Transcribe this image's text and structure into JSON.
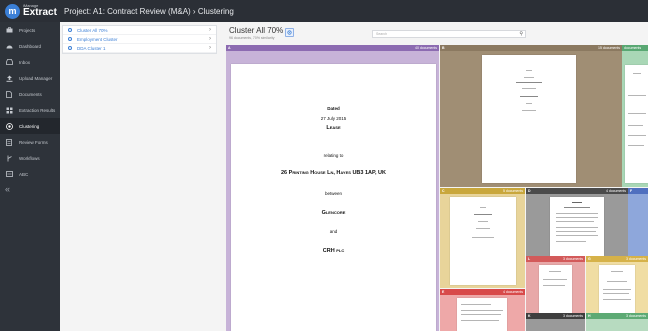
{
  "app": {
    "logo_letter": "m",
    "logo_small": "iManage",
    "logo_big": "Extract",
    "project_title": "Project: A1: Contract Review (M&A) › Clustering"
  },
  "sidebar": {
    "items": [
      {
        "label": "Projects",
        "icon": "briefcase-icon"
      },
      {
        "label": "Dashboard",
        "icon": "dashboard-icon"
      },
      {
        "label": "Inbox",
        "icon": "inbox-icon"
      },
      {
        "label": "Upload Manager",
        "icon": "upload-icon"
      },
      {
        "label": "Documents",
        "icon": "document-icon"
      },
      {
        "label": "Extraction Results",
        "icon": "grid-icon"
      },
      {
        "label": "Clustering",
        "icon": "target-icon",
        "active": true
      },
      {
        "label": "Review Forms",
        "icon": "form-icon"
      },
      {
        "label": "Workflows",
        "icon": "workflow-icon"
      },
      {
        "label": "ABC",
        "icon": "abc-icon"
      }
    ],
    "collapse": "«"
  },
  "cluster_list": [
    {
      "label": "Cluster All 70%"
    },
    {
      "label": "Employment Cluster"
    },
    {
      "label": "DDA Cluster 1"
    }
  ],
  "main": {
    "title": "Cluster All 70%",
    "subtitle": "96 documents, 70% similarity",
    "search_placeholder": "Search"
  },
  "panels": {
    "a": {
      "letter": "A",
      "count": "40 documents"
    },
    "b": {
      "letter": "B",
      "count": "15 documents"
    },
    "b2": {
      "letter": "",
      "count": "documents"
    },
    "c": {
      "letter": "C",
      "count": "5 documents"
    },
    "d": {
      "letter": "D",
      "count": "4 documents"
    },
    "f": {
      "letter": "F",
      "count": ""
    },
    "l": {
      "letter": "L",
      "count": "3 documents"
    },
    "g": {
      "letter": "G",
      "count": "3 documents"
    },
    "e": {
      "letter": "E",
      "count": "4 documents"
    },
    "k": {
      "letter": "K",
      "count": "3 documents"
    },
    "h": {
      "letter": "H",
      "count": "3 documents"
    }
  },
  "lease_doc": {
    "dated": "Dated",
    "date": "27 July 2015",
    "lease": "Lease",
    "relating": "relating to",
    "address": "26 Printing House Ln, Hayes UB3 1AP, UK",
    "between": "between",
    "party1": "Glencore",
    "and": "and",
    "party2": "CRH plc"
  },
  "colors": {
    "accent": "#3b7fd6",
    "sidebar": "#2e333a",
    "topbar": "#2b2f36"
  }
}
